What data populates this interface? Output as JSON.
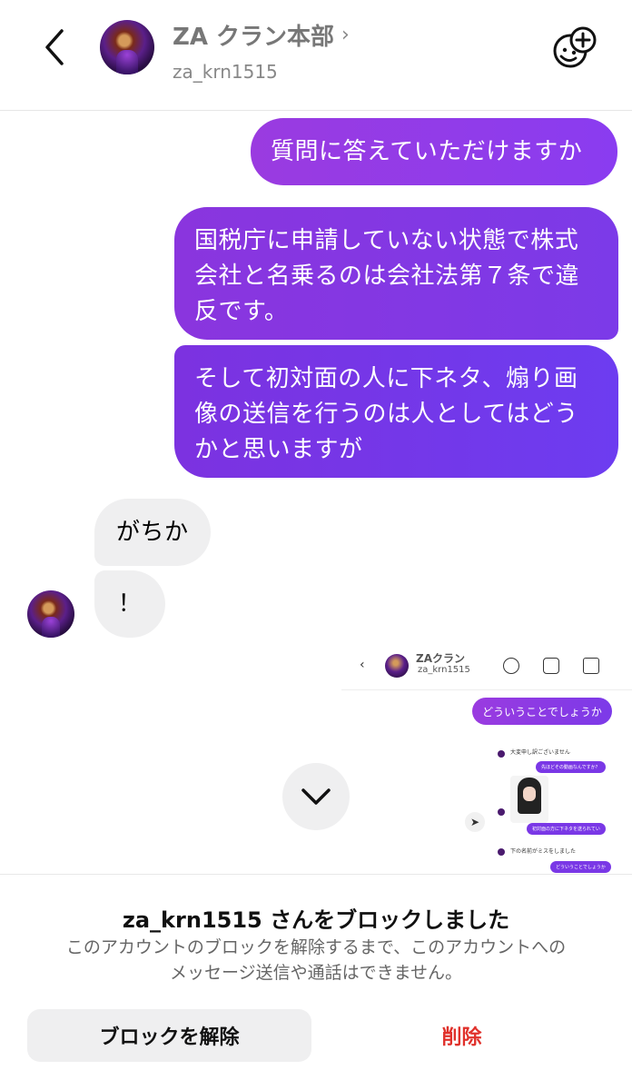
{
  "header": {
    "title": "ZA クラン本部",
    "username": "za_krn1515",
    "back_icon": "chevron-left-icon",
    "sticker_icon": "add-sticker-icon"
  },
  "messages": [
    {
      "direction": "out",
      "text": "質問に答えていただけますか"
    },
    {
      "direction": "out",
      "lines": [
        "国税庁に申請していない状態で株式",
        "会社と名乗るのは会社法第７条で違",
        "反です。"
      ]
    },
    {
      "direction": "out",
      "lines": [
        "そして初対面の人に下ネタ、煽り画",
        "像の送信を行うのは人としてはどう",
        "かと思いますが"
      ]
    },
    {
      "direction": "in",
      "text": "がちか"
    },
    {
      "direction": "in",
      "text": "！"
    }
  ],
  "attachment": {
    "name": "ZAクラン",
    "username": "za_krn1515",
    "bubble": "どういうことでしょうか",
    "tiny_texts": {
      "t1": "大変申し訳ございません",
      "t2": "先ほどその動画なんですか？",
      "t3": "初対面の方に下ネタを送られてい",
      "t4": "下の名前がミスをしました",
      "t5": "どういうことでしょうか"
    }
  },
  "blocked": {
    "title": "za_krn1515 さんをブロックしました",
    "description_line1": "このアカウントのブロックを解除するまで、このアカウントへの",
    "description_line2": "メッセージ送信や通話はできません。",
    "unblock_label": "ブロックを解除",
    "delete_label": "削除"
  },
  "colors": {
    "outgoing_start": "#9a3be0",
    "outgoing_end": "#6d3cf0",
    "incoming_bg": "#efeff0",
    "delete_red": "#e0312b"
  }
}
